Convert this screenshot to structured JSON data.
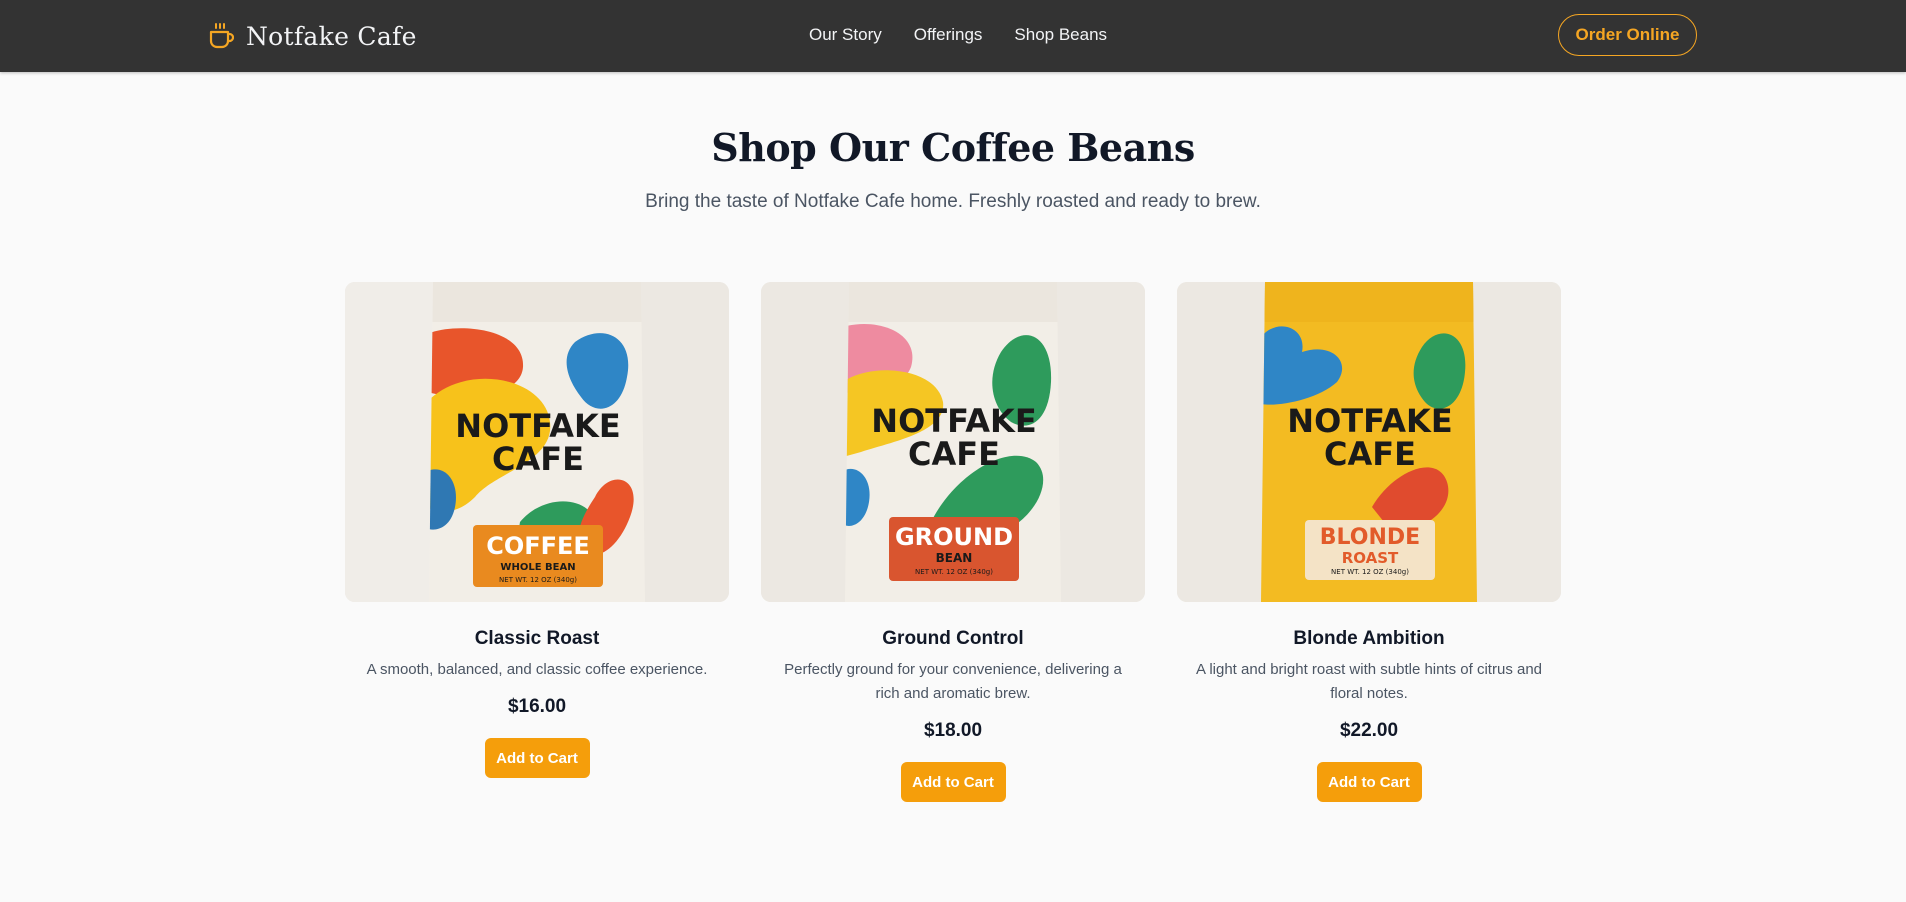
{
  "header": {
    "brand_name": "Notfake Cafe",
    "brand_icon": "coffee-cup-icon",
    "nav": [
      "Our Story",
      "Offerings",
      "Shop Beans"
    ],
    "order_label": "Order Online"
  },
  "colors": {
    "header_bg": "#333333",
    "accent": "#f5a623",
    "button": "#f59e0b",
    "page_bg": "#fafafa"
  },
  "main": {
    "title": "Shop Our Coffee Beans",
    "subtitle": "Bring the taste of Notfake Cafe home. Freshly roasted and ready to brew."
  },
  "products": [
    {
      "name": "Classic Roast",
      "description": "A smooth, balanced, and classic coffee experience.",
      "price": "$16.00",
      "button": "Add to Cart",
      "bag": {
        "brand_line1": "NOTFAKE",
        "brand_line2": "CAFE",
        "label_main": "COFFEE",
        "label_sub": "WHOLE BEAN",
        "net_wt": "NET WT. 12 OZ (340g)"
      }
    },
    {
      "name": "Ground Control",
      "description": "Perfectly ground for your convenience, delivering a rich and aromatic brew.",
      "price": "$18.00",
      "button": "Add to Cart",
      "bag": {
        "brand_line1": "NOTFAKE",
        "brand_line2": "CAFE",
        "label_main": "GROUND",
        "label_sub": "BEAN",
        "net_wt": "NET WT. 12 OZ (340g)"
      }
    },
    {
      "name": "Blonde Ambition",
      "description": "A light and bright roast with subtle hints of citrus and floral notes.",
      "price": "$22.00",
      "button": "Add to Cart",
      "bag": {
        "brand_line1": "NOTFAKE",
        "brand_line2": "CAFE",
        "label_main": "BLONDE",
        "label_sub": "ROAST",
        "net_wt": "NET WT. 12 OZ (340g)"
      }
    }
  ]
}
